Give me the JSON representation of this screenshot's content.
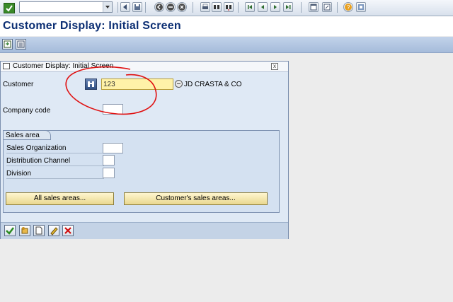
{
  "system_toolbar": {
    "command_field_value": "",
    "icons": [
      "enter-check-icon",
      "back-icon",
      "save-icon",
      "back-arrow-icon",
      "exit-icon",
      "cancel-icon",
      "print-icon",
      "find-icon",
      "find-next-icon",
      "first-page-icon",
      "previous-page-icon",
      "next-page-icon",
      "last-page-icon",
      "create-session-icon",
      "shortcut-icon",
      "help-icon",
      "customize-layout-icon"
    ]
  },
  "title": "Customer Display: Initial Screen",
  "dialog": {
    "title": "Customer Display: Initial Screen",
    "close_label": "x",
    "customer_label": "Customer",
    "customer_value": "123",
    "customer_name": "JD CRASTA & CO",
    "company_code_label": "Company code",
    "company_code_value": "",
    "sales_area": {
      "group_label": "Sales area",
      "sales_org_label": "Sales Organization",
      "sales_org_value": "",
      "distribution_channel_label": "Distribution Channel",
      "distribution_channel_value": "",
      "division_label": "Division",
      "division_value": "",
      "all_sales_areas_label": "All sales areas...",
      "customers_sales_areas_label": "Customer's sales areas..."
    },
    "footer_icons": [
      "continue-check-icon",
      "other-customer-icon",
      "create-icon",
      "change-icon",
      "cancel-icon"
    ]
  },
  "colors": {
    "title_text": "#0b2e73",
    "required_field": "#fff2a8",
    "annotation": "#e01010"
  }
}
